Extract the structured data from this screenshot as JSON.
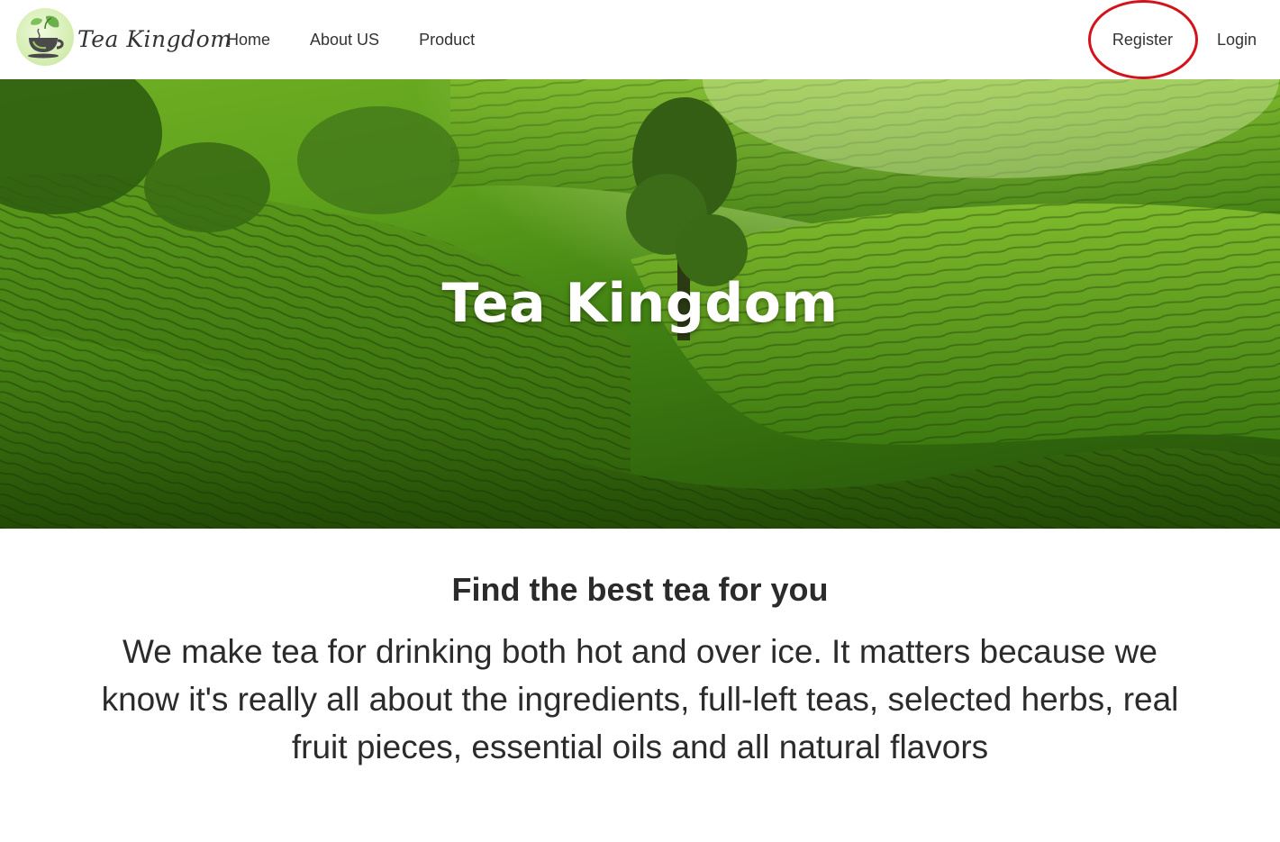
{
  "brand": {
    "name": "Tea Kingdom",
    "logo_icon": "tea-cup-leaf-logo",
    "logo_colors": {
      "leaf": "#6ab04c",
      "cup": "#4a4a4a",
      "bg": "#d6eeb3"
    }
  },
  "nav": {
    "links": [
      {
        "label": "Home"
      },
      {
        "label": "About US"
      },
      {
        "label": "Product"
      }
    ],
    "register_label": "Register",
    "login_label": "Login",
    "highlight_color": "#d4121a"
  },
  "hero": {
    "title": "Tea Kingdom",
    "image": "tea-plantation-hills-photo"
  },
  "content": {
    "headline": "Find the best tea for you",
    "lead": "We make tea for drinking both hot and over ice. It matters because we know it's really all about the ingredients, full-left teas, selected herbs, real fruit pieces, essential oils and all natural flavors"
  }
}
